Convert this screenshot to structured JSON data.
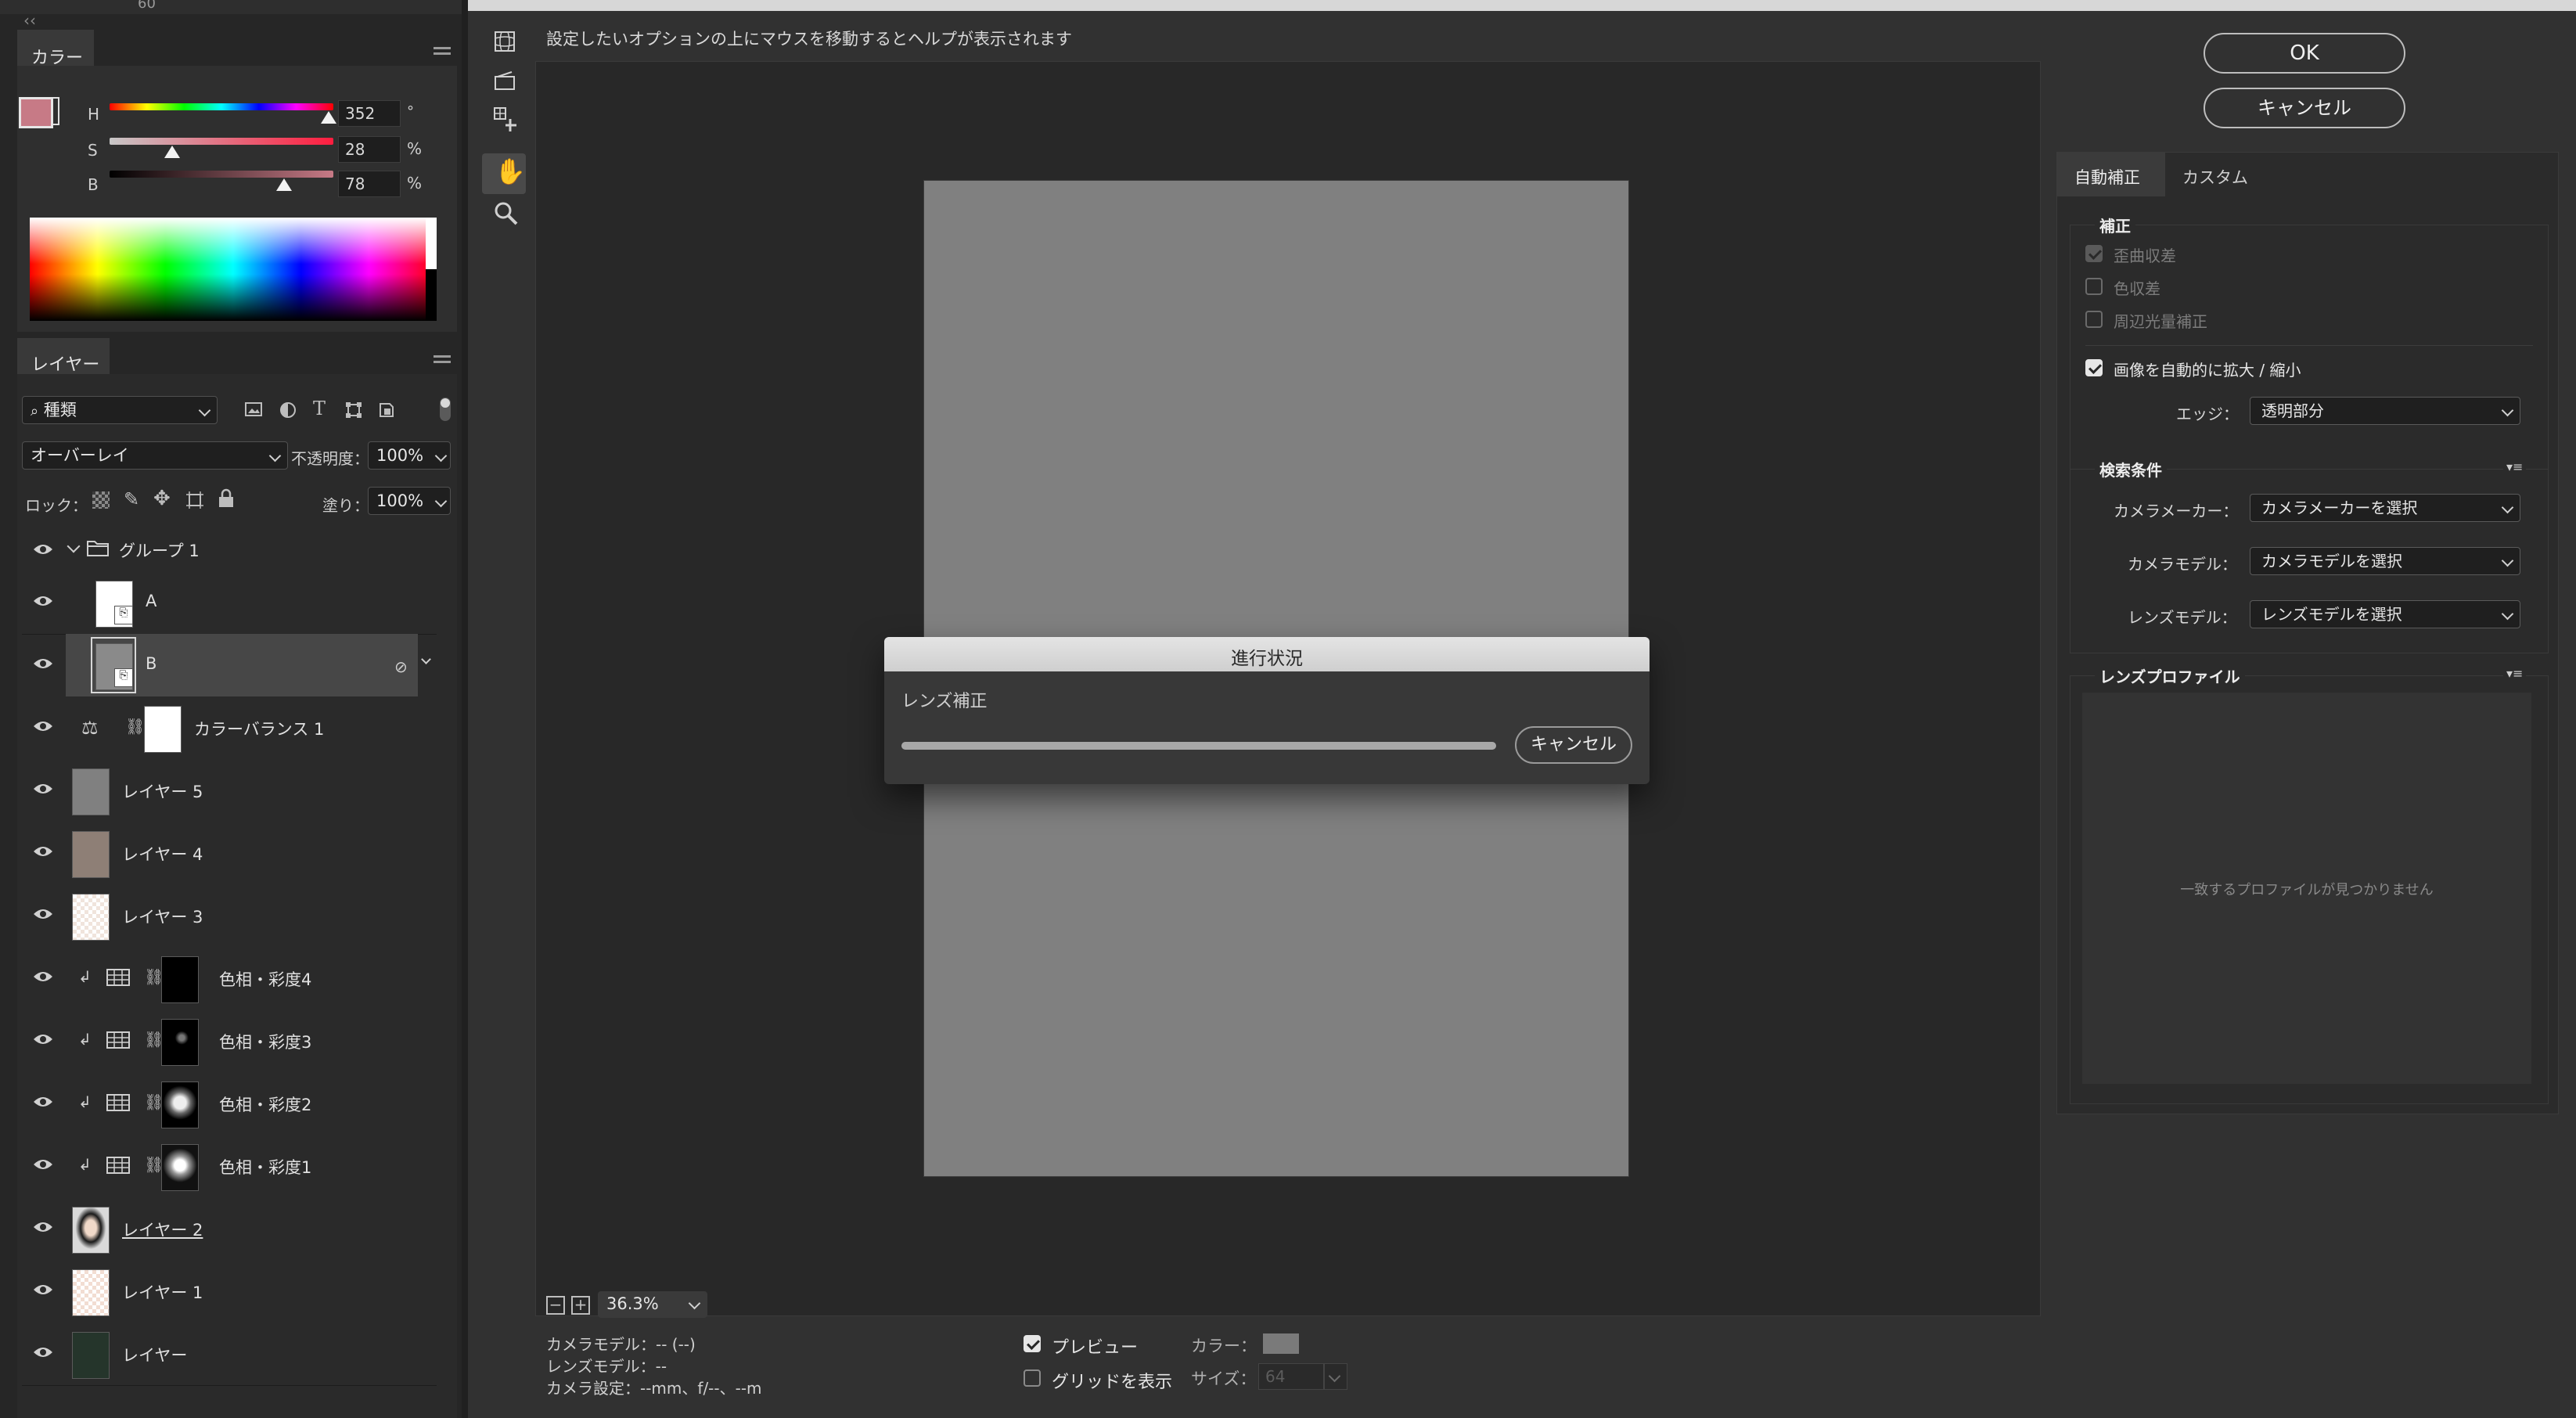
{
  "left": {
    "top_ruler_value": "60",
    "color_panel": {
      "title": "カラー",
      "h_label": "H",
      "h_value": "352",
      "h_unit": "°",
      "s_label": "S",
      "s_value": "28",
      "s_unit": "%",
      "b_label": "B",
      "b_value": "78",
      "b_unit": "%",
      "h_fraction": 0.978,
      "s_fraction": 0.28,
      "b_fraction": 0.78,
      "foreground_color": "#c77a86"
    },
    "layers_panel": {
      "title": "レイヤー",
      "filter_label": "種類",
      "blend_mode": "オーバーレイ",
      "opacity_label": "不透明度：",
      "opacity_value": "100%",
      "lock_label": "ロック：",
      "fill_label": "塗り：",
      "fill_value": "100%",
      "layers": [
        {
          "name": "グループ 1"
        },
        {
          "name": "A"
        },
        {
          "name": "B"
        },
        {
          "name": "カラーバランス 1"
        },
        {
          "name": "レイヤー 5"
        },
        {
          "name": "レイヤー 4"
        },
        {
          "name": "レイヤー 3"
        },
        {
          "name": "色相・彩度4"
        },
        {
          "name": "色相・彩度3"
        },
        {
          "name": "色相・彩度2"
        },
        {
          "name": "色相・彩度1"
        },
        {
          "name": "レイヤー 2"
        },
        {
          "name": "レイヤー 1"
        },
        {
          "name": "レイヤー"
        }
      ]
    }
  },
  "dialog": {
    "help_text": "設定したいオプションの上にマウスを移動するとヘルプが表示されます",
    "ok_label": "OK",
    "cancel_label": "キャンセル",
    "tabs": [
      "自動補正",
      "カスタム"
    ],
    "correction": {
      "title": "補正",
      "geometric_distortion": "歪曲収差",
      "chromatic_aberration": "色収差",
      "vignette": "周辺光量補正",
      "auto_scale": "画像を自動的に拡大 / 縮小",
      "edge_label": "エッジ：",
      "edge_value": "透明部分"
    },
    "search": {
      "title": "検索条件",
      "maker_label": "カメラメーカー：",
      "maker_value": "カメラメーカーを選択",
      "model_label": "カメラモデル：",
      "model_value": "カメラモデルを選択",
      "lens_label": "レンズモデル：",
      "lens_value": "レンズモデルを選択"
    },
    "profile": {
      "title": "レンズプロファイル",
      "empty_text": "一致するプロファイルが見つかりません"
    },
    "zoom_value": "36.3%",
    "info": {
      "camera_model": "カメラモデル：-- (--)",
      "lens_model": "レンズモデル：--",
      "camera_settings": "カメラ設定：--mm、f/--、--m"
    },
    "preview_label": "プレビュー",
    "grid_label": "グリッドを表示",
    "color_label": "カラー：",
    "size_label": "サイズ：",
    "size_value": "64"
  },
  "progress": {
    "title": "進行状況",
    "task": "レンズ補正",
    "cancel_label": "キャンセル",
    "fraction": 1.0
  }
}
